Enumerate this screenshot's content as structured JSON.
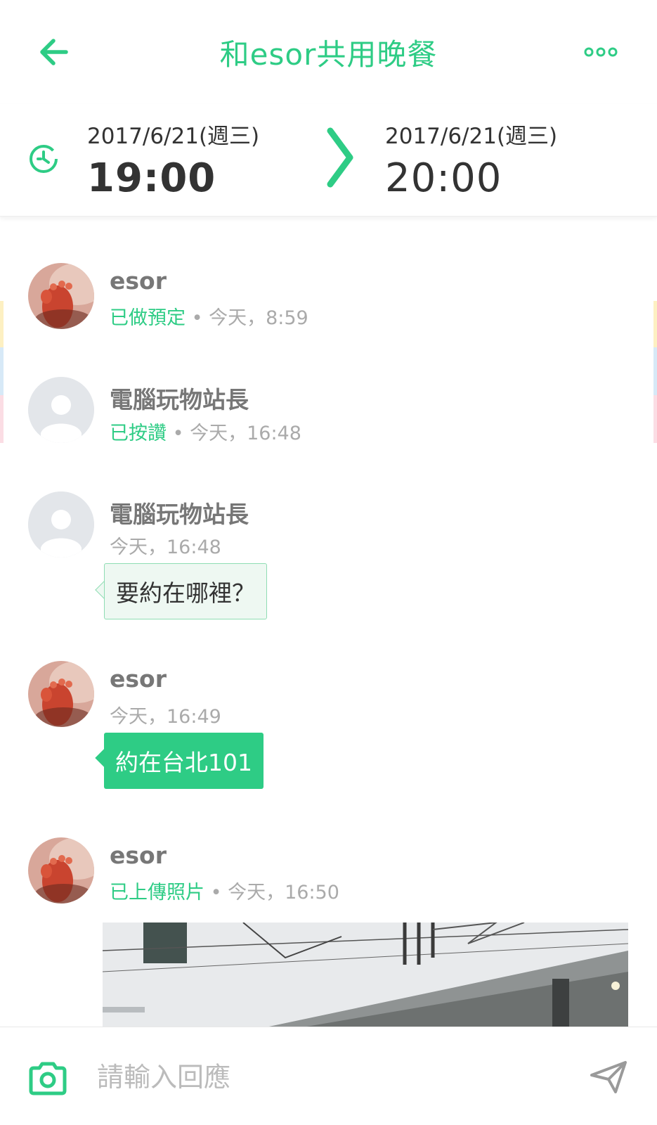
{
  "header": {
    "title": "和esor共用晚餐",
    "back_icon": "back-arrow-icon",
    "more_icon": "more-dots-icon",
    "accent_color": "#2ecc85"
  },
  "event_time": {
    "start_date": "2017/6/21(週三)",
    "start_time": "19:00",
    "end_date": "2017/6/21(週三)",
    "end_time": "20:00",
    "clock_icon": "clock-icon",
    "arrow_icon": "chevron-right-icon"
  },
  "feed": [
    {
      "name": "esor",
      "action": "已做預定",
      "time": "• 今天，8:59"
    },
    {
      "name": "電腦玩物站長",
      "action": "已按讚",
      "time": "• 今天，16:48"
    },
    {
      "name": "電腦玩物站長",
      "time": "今天，16:48",
      "message": "要約在哪裡？"
    },
    {
      "name": "esor",
      "time": "今天，16:49",
      "message": "約在台北101"
    },
    {
      "name": "esor",
      "action": "已上傳照片",
      "time": "• 今天，16:50"
    }
  ],
  "composer": {
    "placeholder": "請輸入回應",
    "camera_icon": "camera-icon",
    "send_icon": "send-icon"
  }
}
